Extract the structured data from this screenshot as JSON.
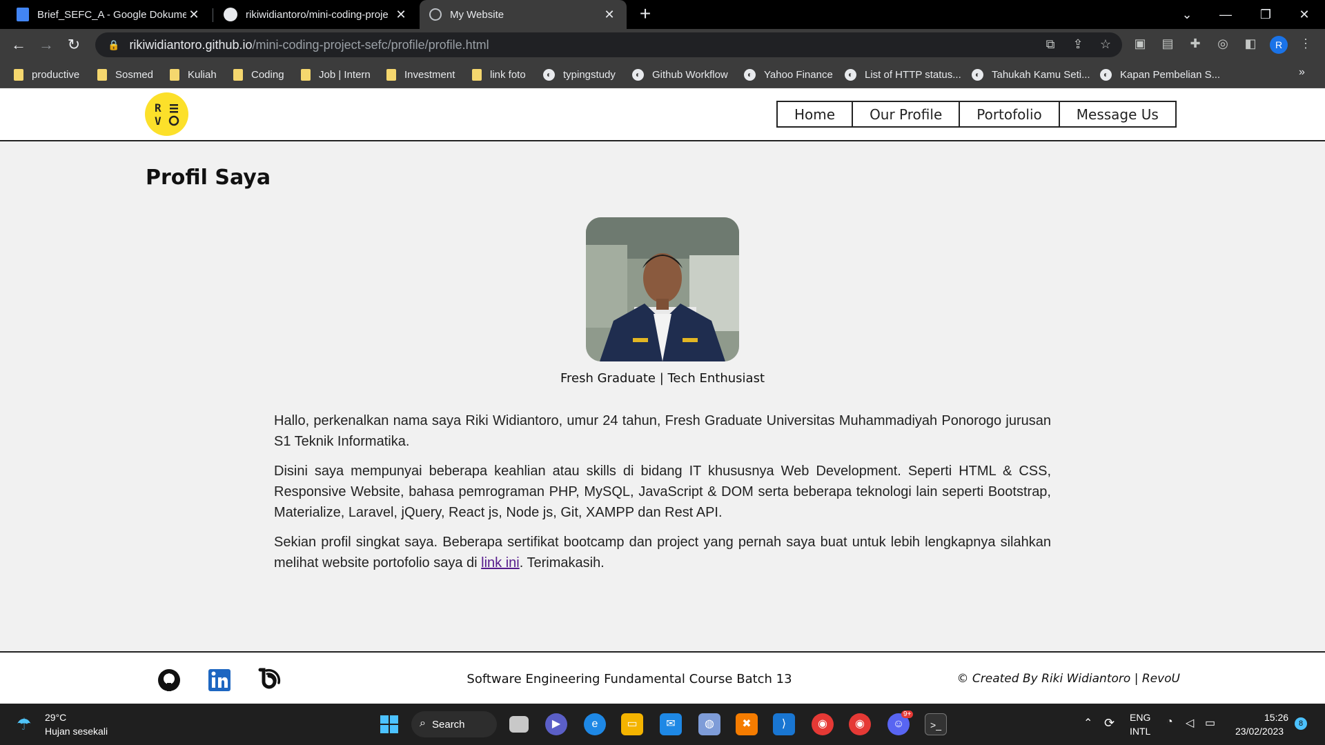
{
  "browser": {
    "tabs": [
      {
        "title": "Brief_SEFC_A - Google Dokumen",
        "icon": "google-docs-icon",
        "active": false
      },
      {
        "title": "rikiwidiantoro/mini-coding-proje",
        "icon": "github-icon",
        "active": false
      },
      {
        "title": "My Website",
        "icon": "globe-icon",
        "active": true
      }
    ],
    "url_host": "rikiwidiantoro.github.io",
    "url_path": "/mini-coding-project-sefc/profile/profile.html",
    "profile_initial": "R",
    "bookmarks": [
      {
        "label": "productive",
        "type": "folder"
      },
      {
        "label": "Sosmed",
        "type": "folder"
      },
      {
        "label": "Kuliah",
        "type": "folder"
      },
      {
        "label": "Coding",
        "type": "folder"
      },
      {
        "label": "Job | Intern",
        "type": "folder"
      },
      {
        "label": "Investment",
        "type": "folder"
      },
      {
        "label": "link foto",
        "type": "folder"
      },
      {
        "label": "typingstudy",
        "type": "page"
      },
      {
        "label": "Github Workflow",
        "type": "page"
      },
      {
        "label": "Yahoo Finance",
        "type": "page"
      },
      {
        "label": "List of HTTP status...",
        "type": "page"
      },
      {
        "label": "Tahukah Kamu Seti...",
        "type": "page"
      },
      {
        "label": "Kapan Pembelian S...",
        "type": "page"
      }
    ],
    "bookmarks_more": "»"
  },
  "site": {
    "logo_text": "R ≡\nV O",
    "nav": [
      "Home",
      "Our Profile",
      "Portofolio",
      "Message Us"
    ],
    "page_title": "Profil Saya",
    "tagline": "Fresh Graduate | Tech Enthusiast",
    "bio": {
      "p1": "Hallo, perkenalkan nama saya Riki Widiantoro, umur 24 tahun, Fresh Graduate Universitas Muhammadiyah Ponorogo jurusan S1 Teknik Informatika.",
      "p2": "Disini saya mempunyai beberapa keahlian atau skills di bidang IT khususnya Web Development. Seperti HTML & CSS, Responsive Website, bahasa pemrograman PHP, MySQL, JavaScript & DOM serta beberapa teknologi lain seperti Bootstrap, Materialize, Laravel, jQuery, React js, Node js, Git, XAMPP dan Rest API.",
      "p3_before": "Sekian profil singkat saya. Beberapa sertifikat bootcamp dan project yang pernah saya buat untuk lebih lengkapnya silahkan melihat website portofolio saya di ",
      "p3_link": "link ini",
      "p3_after": ". Terimakasih."
    },
    "footer": {
      "icons": [
        "github-icon",
        "linkedin-icon",
        "blog-icon"
      ],
      "course": "Software Engineering Fundamental Course Batch 13",
      "credit": "© Created By Riki Widiantoro | RevoU"
    }
  },
  "taskbar": {
    "weather_temp": "29°C",
    "weather_desc": "Hujan sesekali",
    "search_label": "Search",
    "lang_line1": "ENG",
    "lang_line2": "INTL",
    "time": "15:26",
    "date": "23/02/2023",
    "notification_count": "8",
    "discord_badge": "9+"
  },
  "colors": {
    "accent_logo": "#fce02a",
    "link_visited": "#551a8b",
    "page_bg": "#f1f1f1"
  }
}
